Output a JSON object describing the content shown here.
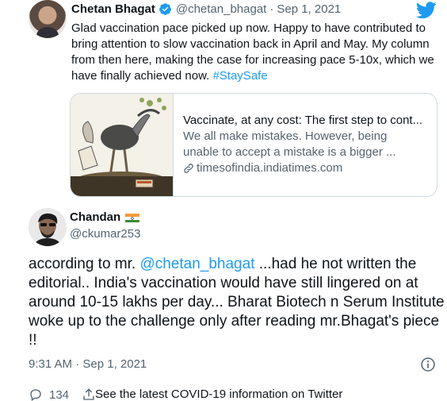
{
  "quoted": {
    "name": "Chetan Bhagat",
    "handle": "@chetan_bhagat",
    "separator": "·",
    "date": "Sep 1, 2021",
    "text_main": "Glad vaccination pace picked up now. Happy to have contributed to bring attention to slow vaccination back in April and May. My column from then here, making the case for increasing pace 5-10x, which we have finally achieved now. ",
    "hashtag": "#StaySafe",
    "card": {
      "title": "Vaccinate, at any cost: The first step to cont...",
      "description": "We all make mistakes. However, being unable to accept a mistake is a bigger ...",
      "domain": "timesofindia.indiatimes.com"
    }
  },
  "tweet": {
    "author_name": "Chandan",
    "author_handle": "@ckumar253",
    "text_before": "according to mr. ",
    "mention": "@chetan_bhagat",
    "text_after": " ...had he not written the editorial.. India's vaccination would have still lingered on at around 10-15 lakhs per day... Bharat Biotech n Serum Institute woke up to the challenge only after reading mr.Bhagat's piece !!",
    "timestamp": "9:31 AM · Sep 1, 2021",
    "reply_count": "134",
    "covid_link": "See the latest COVID-19 information on Twitter"
  },
  "icons": {
    "verified": "verified-badge-icon",
    "twitter": "twitter-bird-icon",
    "link": "link-icon",
    "info": "info-icon",
    "flag": "india-flag-icon",
    "reply": "reply-icon",
    "share": "share-icon"
  },
  "colors": {
    "link_blue": "#1d9bf0",
    "secondary_text": "#536471",
    "border": "#cfd9de"
  }
}
